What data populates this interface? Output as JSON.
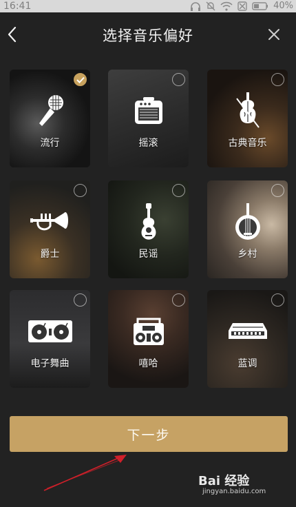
{
  "status_bar": {
    "time": "16:41",
    "battery": "40%"
  },
  "header": {
    "title": "选择音乐偏好"
  },
  "genres": [
    {
      "label": "流行",
      "icon": "microphone-icon",
      "selected": true
    },
    {
      "label": "摇滚",
      "icon": "amplifier-icon",
      "selected": false
    },
    {
      "label": "古典音乐",
      "icon": "violin-icon",
      "selected": false
    },
    {
      "label": "爵士",
      "icon": "trumpet-icon",
      "selected": false
    },
    {
      "label": "民谣",
      "icon": "ukulele-icon",
      "selected": false
    },
    {
      "label": "乡村",
      "icon": "banjo-icon",
      "selected": false
    },
    {
      "label": "电子舞曲",
      "icon": "turntable-icon",
      "selected": false
    },
    {
      "label": "嘻哈",
      "icon": "boombox-icon",
      "selected": false
    },
    {
      "label": "蓝调",
      "icon": "harmonica-icon",
      "selected": false
    }
  ],
  "next_button": {
    "label": "下一步"
  },
  "watermark": {
    "logo": "Bai 经验",
    "url": "jingyan.baidu.com"
  },
  "colors": {
    "accent": "#c6a264",
    "background": "#222222",
    "annotation_arrow": "#d0202a"
  }
}
